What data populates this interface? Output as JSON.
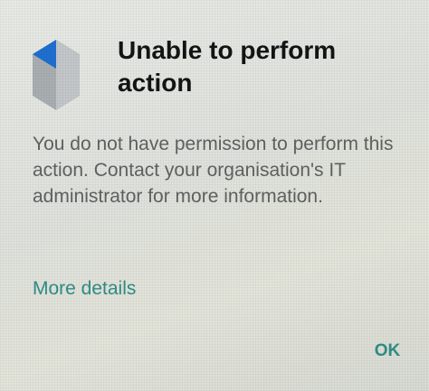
{
  "dialog": {
    "icon": "device-admin-icon",
    "title": "Unable to perform action",
    "message": "You do not have permission to perform this action. Contact your organisation's IT administrator for more information.",
    "more_details_label": "More details",
    "ok_label": "OK"
  },
  "colors": {
    "accent": "#2f8d86",
    "title_text": "#141414",
    "body_text": "#5f625f",
    "icon_blue": "#1f6fd1",
    "icon_gray": "#a9aeb2"
  }
}
